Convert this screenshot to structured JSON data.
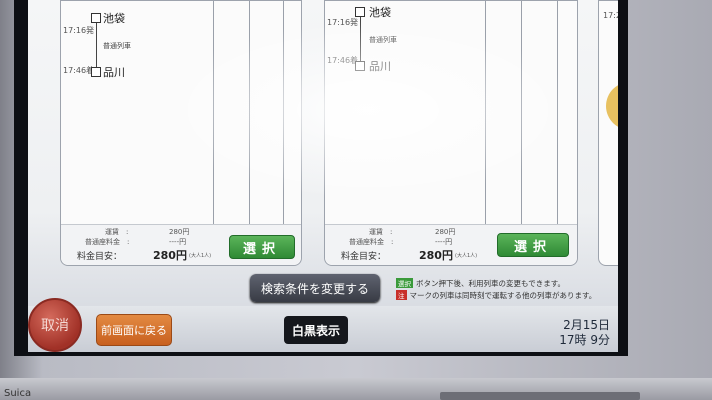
{
  "route_cards": [
    {
      "from_station": "池袋",
      "to_station": "品川",
      "depart_time": "17:16発",
      "arrive_time": "17:46着",
      "train_type": "普通列車",
      "fare_row1_label": "運賃　:",
      "fare_row1_value": "280円",
      "fare_row2_label": "普通座料金　:",
      "fare_row2_value": "----円",
      "fare_total_label": "料金目安：",
      "fare_total_value": "280円",
      "fare_total_note": "(大人1人)",
      "select_label": "選択"
    },
    {
      "from_station": "池袋",
      "to_station": "品川",
      "depart_time": "17:16発",
      "arrive_time": "17:46着",
      "train_type": "普通列車",
      "fare_row1_label": "運賃　:",
      "fare_row1_value": "280円",
      "fare_row2_label": "普通座料金　:",
      "fare_row2_value": "----円",
      "fare_total_label": "料金目安：",
      "fare_total_value": "280円",
      "fare_total_note": "(大人1人)",
      "select_label": "選択"
    }
  ],
  "third_card_time": "17:2",
  "change_conditions_label": "検索条件を変更する",
  "notes": [
    {
      "tag": "選択",
      "tag_color": "#3a9a3a",
      "text": "ボタン押下後、利用列車の変更もできます。"
    },
    {
      "tag": "注",
      "tag_color": "#c8302a",
      "text": "マークの列車は同時刻で運転する他の列車があります。"
    }
  ],
  "cancel_label": "取消",
  "back_label": "前画面に戻る",
  "monochrome_label": "白黒表示",
  "clock": {
    "date": "2月15日",
    "time": "17時 9分"
  },
  "footer_text": "Suica",
  "colors": {
    "select_green": "#2f8a35",
    "back_orange": "#c8601f",
    "cancel_red": "#a13127",
    "arrow_yellow": "#e8c160"
  }
}
